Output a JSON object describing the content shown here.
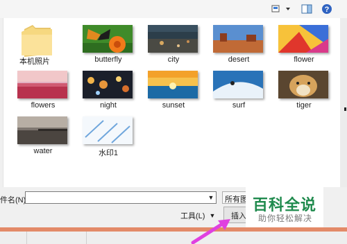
{
  "items": [
    {
      "label": "本机照片",
      "kind": "folder"
    },
    {
      "label": "butterfly",
      "kind": "image"
    },
    {
      "label": "city",
      "kind": "image"
    },
    {
      "label": "desert",
      "kind": "image"
    },
    {
      "label": "flower",
      "kind": "image"
    },
    {
      "label": "flowers",
      "kind": "image"
    },
    {
      "label": "night",
      "kind": "image"
    },
    {
      "label": "sunset",
      "kind": "image"
    },
    {
      "label": "surf",
      "kind": "image"
    },
    {
      "label": "tiger",
      "kind": "image"
    },
    {
      "label": "water",
      "kind": "image"
    },
    {
      "label": "水印1",
      "kind": "image"
    }
  ],
  "filename": {
    "label": "件名(N):",
    "value": ""
  },
  "filetype": {
    "value": "所有图"
  },
  "tools": {
    "label": "工具(L)"
  },
  "insert": {
    "label": "插入"
  },
  "watermark": {
    "title": "百科全说",
    "subtitle": "助你轻松解决"
  },
  "colors": {
    "accent_arrow": "#e040e0",
    "watermark_green": "#1f8a4d",
    "frame_orange": "#e38a68"
  }
}
